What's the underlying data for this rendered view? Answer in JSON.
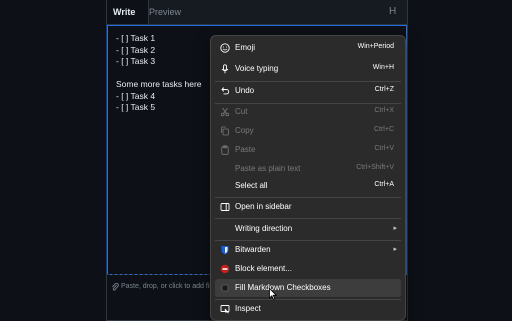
{
  "editor": {
    "tabs": {
      "write": "Write",
      "preview": "Preview",
      "heading": "H"
    },
    "lines": [
      "- [ ] Task 1",
      "- [ ] Task 2",
      "- [ ] Task 3",
      "",
      "Some more tasks here",
      "- [ ] Task 4",
      "- [ ] Task 5"
    ],
    "attach_text": "Paste, drop, or click to add fil"
  },
  "context_menu": {
    "items": [
      {
        "label": "Emoji",
        "shortcut": "Win+Period",
        "icon": "emoji-icon"
      },
      {
        "label": "Voice typing",
        "shortcut": "Win+H",
        "icon": "microphone-icon"
      },
      {
        "label": "Undo",
        "shortcut": "Ctrl+Z",
        "icon": "undo-icon"
      },
      {
        "label": "Cut",
        "shortcut": "Ctrl+X",
        "icon": "cut-icon",
        "disabled": true
      },
      {
        "label": "Copy",
        "shortcut": "Ctrl+C",
        "icon": "copy-icon",
        "disabled": true
      },
      {
        "label": "Paste",
        "shortcut": "Ctrl+V",
        "icon": "paste-icon",
        "disabled": true
      },
      {
        "label": "Paste as plain text",
        "shortcut": "Ctrl+Shift+V",
        "disabled": true
      },
      {
        "label": "Select all",
        "shortcut": "Ctrl+A"
      },
      {
        "label": "Open in sidebar",
        "icon": "sidebar-icon"
      },
      {
        "label": "Writing direction",
        "submenu": true
      },
      {
        "label": "Bitwarden",
        "icon": "bitwarden-icon",
        "submenu": true
      },
      {
        "label": "Block element...",
        "icon": "ublock-icon"
      },
      {
        "label": "Fill Markdown Checkboxes",
        "icon": "extension-icon",
        "hover": true
      },
      {
        "label": "Inspect",
        "icon": "inspect-icon"
      }
    ]
  },
  "colors": {
    "page_bg": "#0d1117",
    "menu_bg": "#2b2b2b",
    "focus_border": "#1f6feb",
    "bitwarden": "#175ddc",
    "ublock": "#c4211b"
  }
}
